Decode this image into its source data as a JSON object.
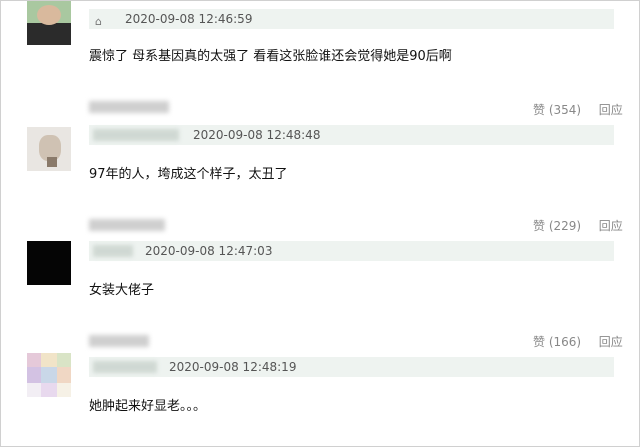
{
  "comments": [
    {
      "timestamp": "2020-09-08 12:46:59",
      "text": "震惊了 母系基因真的太强了 看看这张脸谁还会觉得她是90后啊",
      "like_label": "赞 (354)",
      "reply_label": "回应"
    },
    {
      "timestamp": "2020-09-08 12:48:48",
      "text": "97年的人，垮成这个样子，太丑了",
      "like_label": "赞 (229)",
      "reply_label": "回应"
    },
    {
      "timestamp": "2020-09-08 12:47:03",
      "text": "女装大佬子",
      "like_label": "赞 (166)",
      "reply_label": "回应"
    },
    {
      "timestamp": "2020-09-08 12:48:19",
      "text": "她肿起来好显老。。。",
      "like_label": null,
      "reply_label": null
    }
  ]
}
